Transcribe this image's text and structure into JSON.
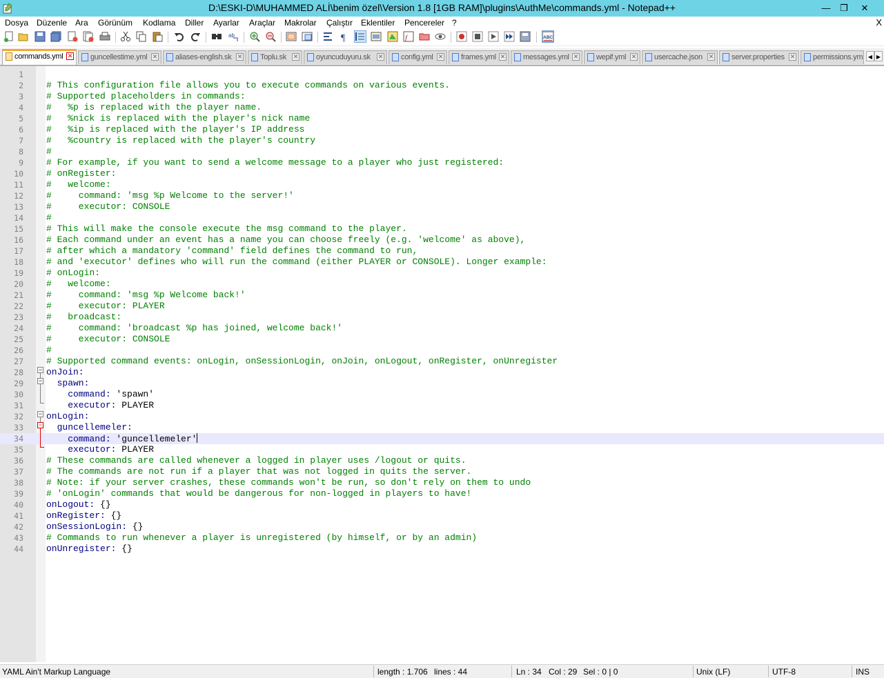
{
  "window": {
    "title": "D:\\ESKI-D\\MUHAMMED ALİ\\benim özel\\Version 1.8 [1GB RAM]\\plugins\\AuthMe\\commands.yml - Notepad++",
    "minimize": "—",
    "restore": "❐",
    "close": "✕"
  },
  "menu": [
    "Dosya",
    "Düzenle",
    "Ara",
    "Görünüm",
    "Kodlama",
    "Diller",
    "Ayarlar",
    "Araçlar",
    "Makrolar",
    "Çalıştır",
    "Eklentiler",
    "Pencereler",
    "?"
  ],
  "menu_close": "X",
  "tabs": [
    {
      "label": "commands.yml",
      "active": true
    },
    {
      "label": "guncellestime.yml",
      "active": false
    },
    {
      "label": "aliases-english.sk",
      "active": false
    },
    {
      "label": "Toplu.sk",
      "active": false
    },
    {
      "label": "oyuncuduyuru.sk",
      "active": false
    },
    {
      "label": "config.yml",
      "active": false
    },
    {
      "label": "frames.yml",
      "active": false
    },
    {
      "label": "messages.yml",
      "active": false
    },
    {
      "label": "wepif.yml",
      "active": false
    },
    {
      "label": "usercache.json",
      "active": false
    },
    {
      "label": "server.properties",
      "active": false
    },
    {
      "label": "permissions.yml",
      "active": false
    }
  ],
  "editor": {
    "current_line": 34,
    "lines": [
      "",
      "# This configuration file allows you to execute commands on various events.",
      "# Supported placeholders in commands:",
      "#   %p is replaced with the player name.",
      "#   %nick is replaced with the player's nick name",
      "#   %ip is replaced with the player's IP address",
      "#   %country is replaced with the player's country",
      "#",
      "# For example, if you want to send a welcome message to a player who just registered:",
      "# onRegister:",
      "#   welcome:",
      "#     command: 'msg %p Welcome to the server!'",
      "#     executor: CONSOLE",
      "#",
      "# This will make the console execute the msg command to the player.",
      "# Each command under an event has a name you can choose freely (e.g. 'welcome' as above),",
      "# after which a mandatory 'command' field defines the command to run,",
      "# and 'executor' defines who will run the command (either PLAYER or CONSOLE). Longer example:",
      "# onLogin:",
      "#   welcome:",
      "#     command: 'msg %p Welcome back!'",
      "#     executor: PLAYER",
      "#   broadcast:",
      "#     command: 'broadcast %p has joined, welcome back!'",
      "#     executor: CONSOLE",
      "#",
      "# Supported command events: onLogin, onSessionLogin, onJoin, onLogout, onRegister, onUnregister",
      "onJoin:",
      "  spawn:",
      "    command: 'spawn'",
      "    executor: PLAYER",
      "onLogin:",
      "  guncellemeler:",
      "    command: 'guncellemeler'",
      "    executor: PLAYER",
      "# These commands are called whenever a logged in player uses /logout or quits.",
      "# The commands are not run if a player that was not logged in quits the server.",
      "# Note: if your server crashes, these commands won't be run, so don't rely on them to undo",
      "# 'onLogin' commands that would be dangerous for non-logged in players to have!",
      "onLogout: {}",
      "onRegister: {}",
      "onSessionLogin: {}",
      "# Commands to run whenever a player is unregistered (by himself, or by an admin)",
      "onUnregister: {}"
    ]
  },
  "status": {
    "language": "YAML Ain't Markup Language",
    "length": "length : 1.706",
    "lines": "lines : 44",
    "ln": "Ln : 34",
    "col": "Col : 29",
    "sel": "Sel : 0 | 0",
    "eol": "Unix (LF)",
    "encoding": "UTF-8",
    "mode": "INS"
  },
  "colors": {
    "titlebar": "#6fd3e6",
    "comment": "#008000",
    "key": "#000080",
    "active_tab_accent": "#f7a833",
    "current_line": "#e8e8ff"
  }
}
